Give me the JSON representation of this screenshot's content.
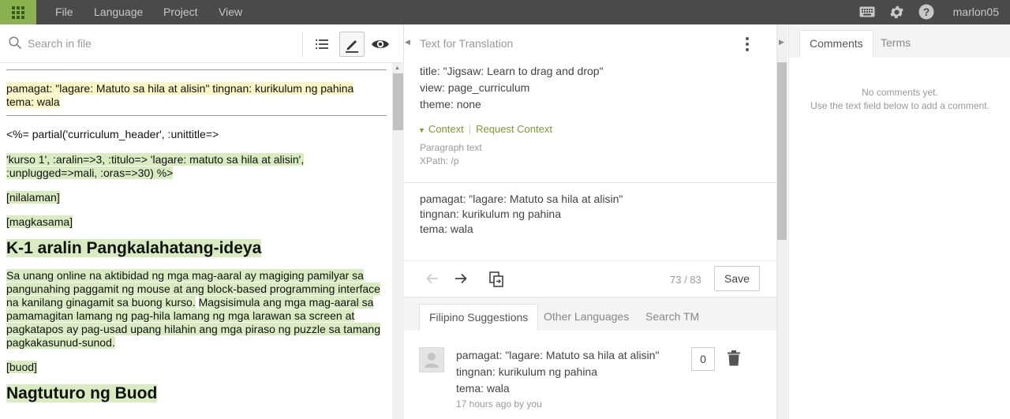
{
  "topbar": {
    "menu": [
      "File",
      "Language",
      "Project",
      "View"
    ],
    "username": "marlon05",
    "icons": [
      "apps-grid-icon",
      "keyboard-icon",
      "gear-icon",
      "help-icon"
    ]
  },
  "left": {
    "search_placeholder": "Search in file",
    "tools": [
      "list-icon",
      "pencil-icon",
      "eye-icon"
    ],
    "doc": {
      "header_line1": "pamagat: \"lagare: Matuto sa hila at alisin\" tingnan: kurikulum ng pahina",
      "header_line2": "tema: wala",
      "partial_line": "<%= partial('curriculum_header', :unittitle=>",
      "kurso_line": "'kurso 1', :aralin=>3, :titulo=> 'lagare: matuto sa hila at alisin', :unplugged=>mali, :oras=>30) %>",
      "nilalaman": "[nilalaman]",
      "magkasama": "[magkasama]",
      "heading1": "K-1 aralin Pangkalahatang-ideya",
      "para1_a": "Sa unang online na aktibidad ng mga mag-aaral ay magiging pamilyar sa pangunahing paggamit ng mouse at ang block-based programming interface na kanilang ginagamit sa buong kurso.",
      "para1_b": "Magsisimula ang mga mag-aaral sa pamamagitan lamang ng pag-hila lamang ng mga larawan sa screen at pagkatapos ay pag-usad upang hilahin ang mga piraso ng puzzle sa tamang pagkakasunud-sunod.",
      "buod": "[buod]",
      "heading2": "Nagtuturo ng Buod"
    }
  },
  "middle": {
    "title": "Text for Translation",
    "source_lines": [
      "title: \"Jigsaw: Learn to drag and drop\"",
      "view: page_curriculum",
      "theme: none"
    ],
    "context_label": "Context",
    "request_context_label": "Request Context",
    "meta_type": "Paragraph text",
    "meta_xpath": "XPath: /p",
    "translation_lines": [
      "pamagat: \"lagare: Matuto sa hila at alisin\"",
      "tingnan: kurikulum ng pahina",
      "tema: wala"
    ],
    "counter": "73 / 83",
    "save_label": "Save",
    "tabs": [
      "Filipino Suggestions",
      "Other Languages",
      "Search TM"
    ],
    "suggestion": {
      "lines": [
        "pamagat: \"lagare: Matuto sa hila at alisin\"",
        "tingnan: kurikulum ng pahina",
        "tema: wala"
      ],
      "time": "17 hours ago by you",
      "votes": "0"
    }
  },
  "right": {
    "tabs": [
      "Comments",
      "Terms"
    ],
    "empty_line1": "No comments yet.",
    "empty_line2": "Use the text field below to add a comment."
  },
  "colors": {
    "accent_green": "#8bb24e",
    "context_green": "#7c9a2e",
    "topbar": "#4a4a4a",
    "highlight_yellow": "#f7f6c4",
    "highlight_green": "#d9ecc1"
  }
}
